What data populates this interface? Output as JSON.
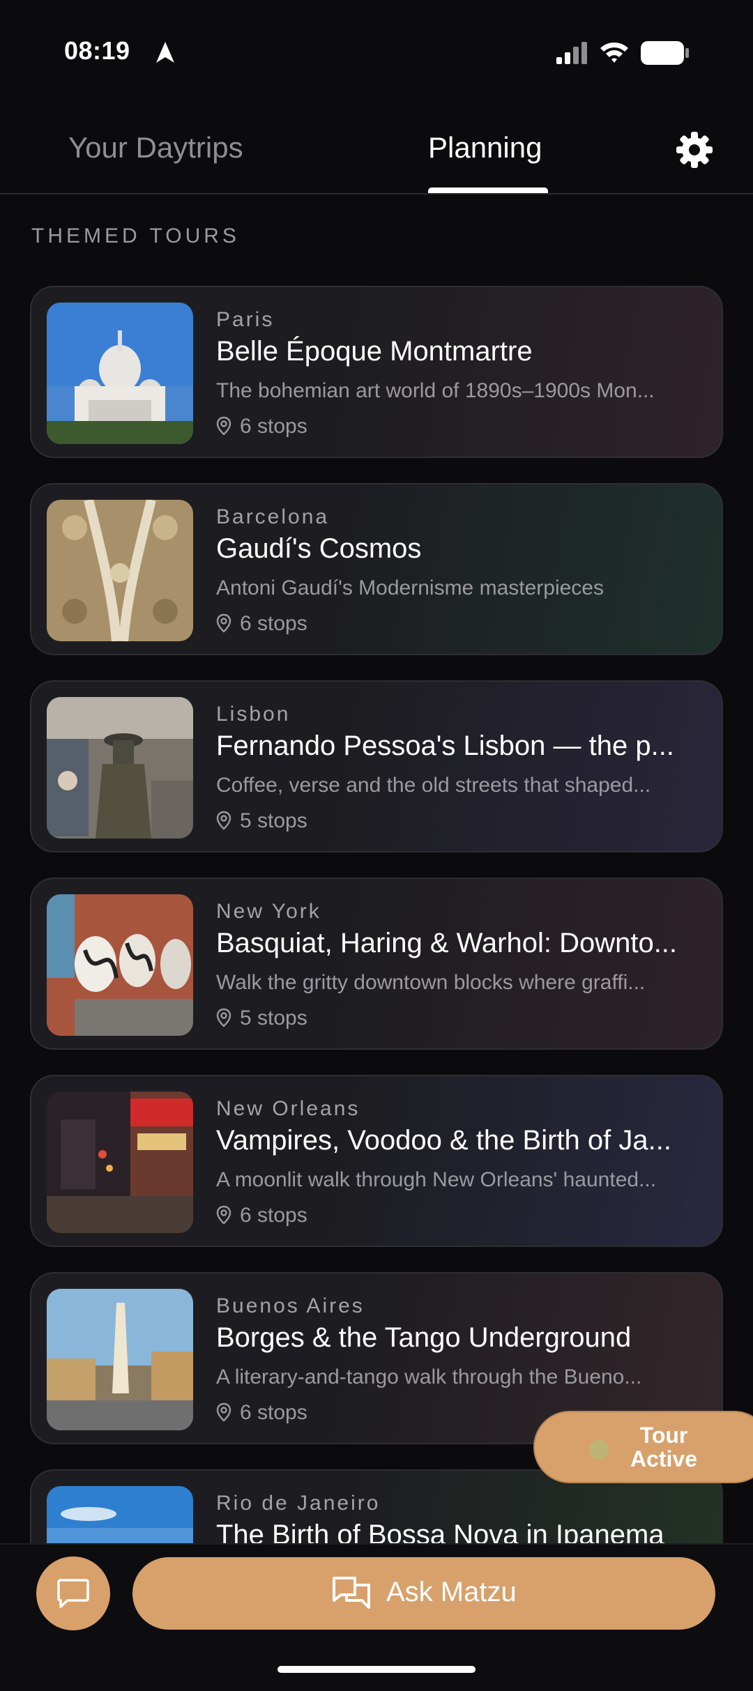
{
  "status_bar": {
    "time": "08:19"
  },
  "tabs": {
    "inactive": "Your Daytrips",
    "active": "Planning"
  },
  "section_title": "THEMED TOURS",
  "tours": [
    {
      "city": "Paris",
      "title": "Belle Époque Montmartre",
      "description": "The bohemian art world of 1890s–1900s Mon...",
      "stops": "6 stops"
    },
    {
      "city": "Barcelona",
      "title": "Gaudí's Cosmos",
      "description": "Antoni Gaudí's Modernisme masterpieces",
      "stops": "6 stops"
    },
    {
      "city": "Lisbon",
      "title": "Fernando Pessoa's Lisbon — the p...",
      "description": "Coffee, verse and the old streets that shaped...",
      "stops": "5 stops"
    },
    {
      "city": "New York",
      "title": "Basquiat, Haring & Warhol: Downto...",
      "description": "Walk the gritty downtown blocks where graffi...",
      "stops": "5 stops"
    },
    {
      "city": "New Orleans",
      "title": "Vampires, Voodoo & the Birth of Ja...",
      "description": "A moonlit walk through New Orleans' haunted...",
      "stops": "6 stops"
    },
    {
      "city": "Buenos Aires",
      "title": "Borges & the Tango Underground",
      "description": "A literary-and-tango walk through the Bueno...",
      "stops": "6 stops"
    },
    {
      "city": "Rio de Janeiro",
      "title": "The Birth of Bossa Nova in Ipanema",
      "description": "",
      "stops": ""
    }
  ],
  "floating": {
    "tour_active": "Tour Active"
  },
  "bottom_bar": {
    "ask_label": "Ask Matzu"
  },
  "colors": {
    "accent": "#d8a06b",
    "background": "#0b0b0d"
  },
  "icons": [
    "location-arrow-icon",
    "cellular-signal-icon",
    "wifi-icon",
    "battery-icon",
    "gear-icon",
    "map-pin-icon",
    "chat-bubble-icon",
    "chat-bubbles-icon"
  ]
}
